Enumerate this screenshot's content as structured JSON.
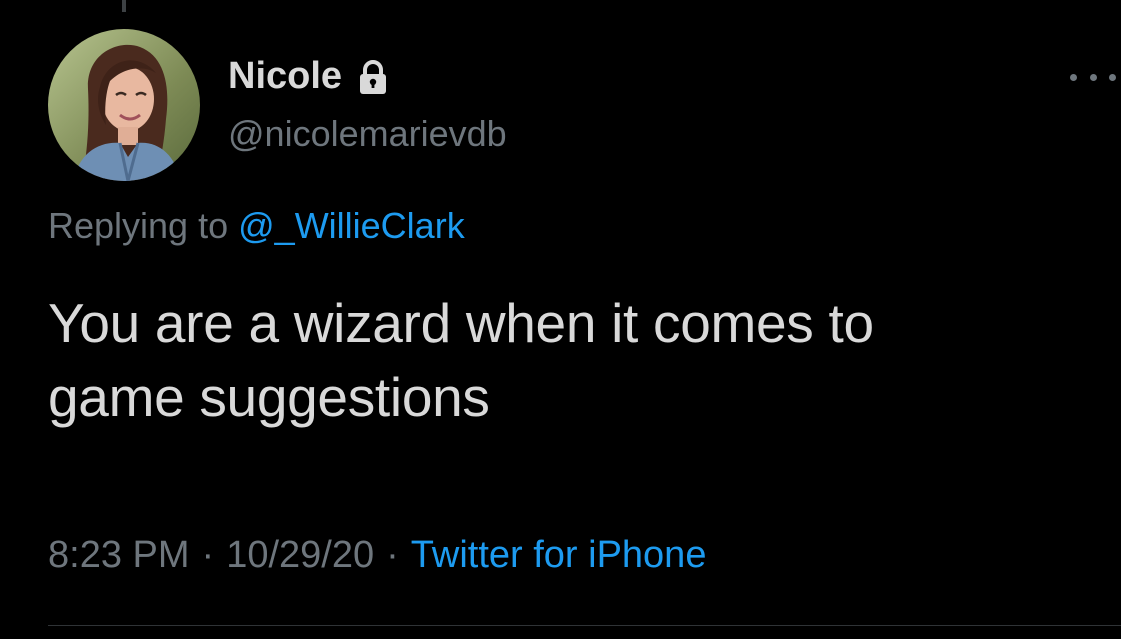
{
  "tweet": {
    "display_name": "Nicole",
    "handle": "@nicolemarievdb",
    "replying_prefix": "Replying to",
    "replying_to": "@_WillieClark",
    "text_line_1": "You are a wizard when it comes to",
    "text_line_2": "game suggestions",
    "time": "8:23 PM",
    "separator": "·",
    "date": "10/29/20",
    "source": "Twitter for iPhone",
    "protected_icon": "lock-icon",
    "more_icon": "more-horizontal-icon"
  },
  "colors": {
    "background": "#000000",
    "primary_text": "#d9d9d9",
    "secondary_text": "#6e767d",
    "link": "#1d9bf0",
    "divider": "#2f3336"
  }
}
